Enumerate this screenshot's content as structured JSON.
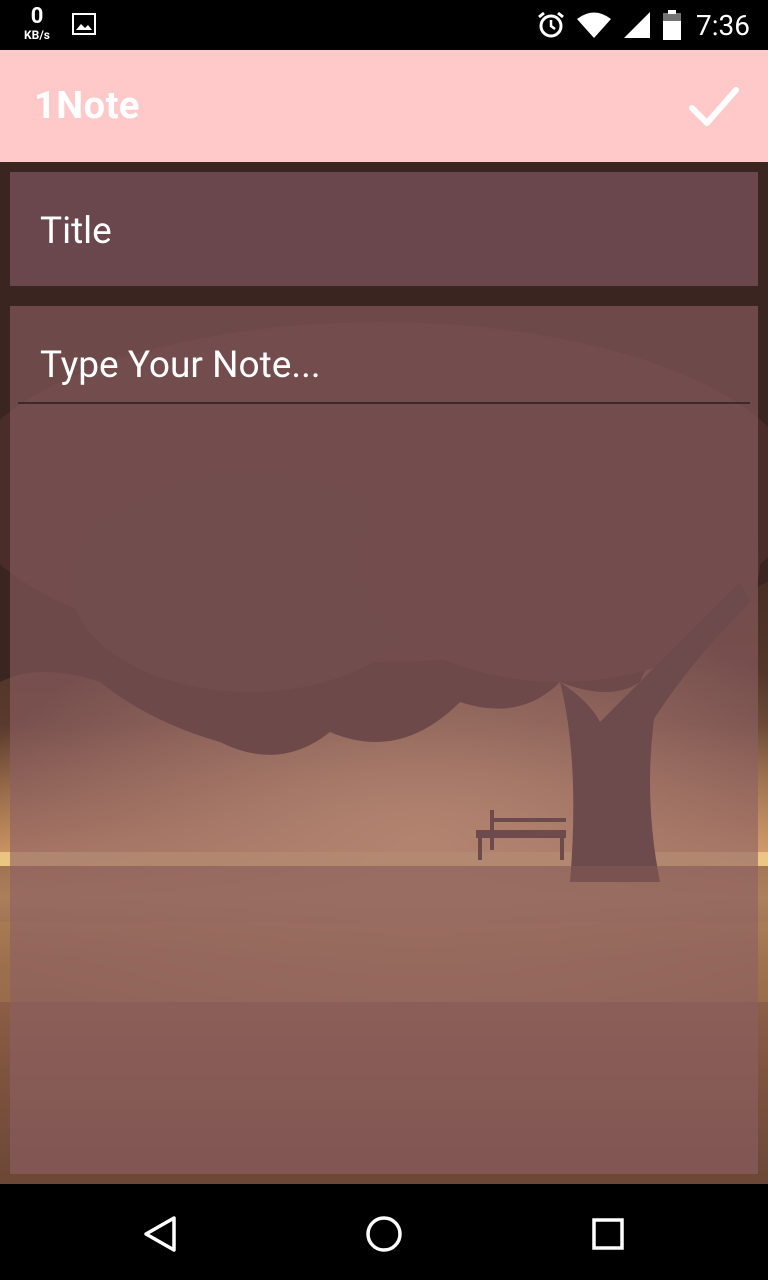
{
  "status_bar": {
    "net_speed": "0",
    "net_unit": "KB/s",
    "time": "7:36",
    "icons": [
      "gallery-icon",
      "alarm-icon",
      "wifi-icon",
      "signal-icon",
      "battery-icon"
    ]
  },
  "app_bar": {
    "title": "1Note",
    "confirm_icon": "check-icon"
  },
  "editor": {
    "title_placeholder": "Title",
    "note_placeholder": "Type Your Note..."
  },
  "nav_bar": {
    "icons": [
      "back-icon",
      "home-icon",
      "recents-icon"
    ]
  },
  "colors": {
    "app_bar": "#ffc9c9",
    "app_bar_text": "#ffffff"
  }
}
